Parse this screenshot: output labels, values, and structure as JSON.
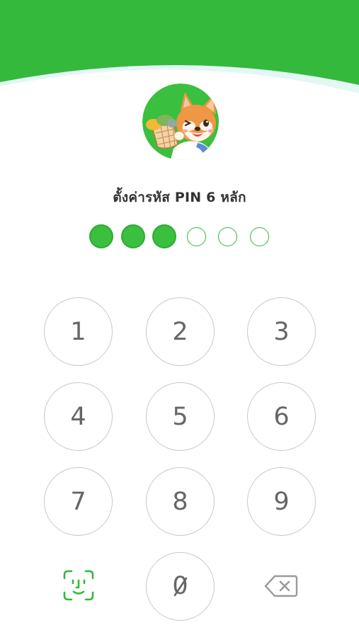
{
  "title": "ตั้งค่ารหัส PIN 6 หลัก",
  "pin": {
    "length": 6,
    "entered": 3
  },
  "keypad": {
    "keys": [
      "1",
      "2",
      "3",
      "4",
      "5",
      "6",
      "7",
      "8",
      "9",
      "0"
    ],
    "left_icon": "face-id-icon",
    "right_icon": "backspace-icon"
  },
  "colors": {
    "brand_green": "#33b83a",
    "key_border": "#c9c9c9",
    "key_text": "#666666",
    "title_text": "#333333"
  }
}
